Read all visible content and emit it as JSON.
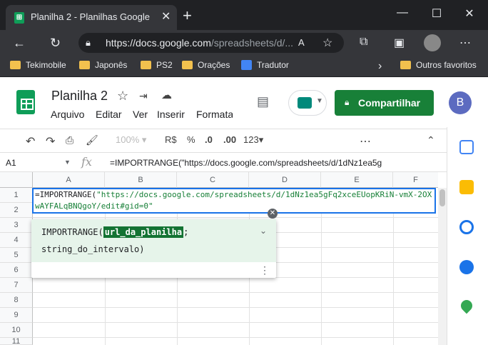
{
  "browser": {
    "tab_title": "Planilha 2 - Planilhas Google",
    "tab_favicon": "sheets-icon",
    "url_main": "https://docs.google.com",
    "url_path": "/spreadsheets/d/...",
    "bookmarks": [
      "Tekimobile",
      "Japonês",
      "PS2",
      "Orações",
      "Tradutor"
    ],
    "other_favorites": "Outros favoritos",
    "bookmarks_more": "›"
  },
  "app": {
    "title": "Planilha 2",
    "menus": [
      "Arquivo",
      "Editar",
      "Ver",
      "Inserir",
      "Formata"
    ],
    "share_label": "Compartilhar",
    "avatar_letter": "B",
    "accent": "#188038"
  },
  "toolbar": {
    "zoom": "100%",
    "currency": "R$",
    "percent": "%",
    "dec_less": ".0",
    "dec_more": ".00",
    "format": "123"
  },
  "formula_bar": {
    "cell_ref": "A1",
    "fx": "fx",
    "text": "=IMPORTRANGE(\"https://docs.google.com/spreadsheets/d/1dNz1ea5g"
  },
  "grid": {
    "columns": [
      "A",
      "B",
      "C",
      "D",
      "E",
      "F"
    ],
    "rows": [
      "1",
      "2",
      "3",
      "4",
      "5",
      "6",
      "7",
      "8",
      "9",
      "10",
      "11"
    ]
  },
  "editor": {
    "fn": "=IMPORTRANGE(",
    "arg": "\"https://docs.google.com/spreadsheets/d/1dNz1ea5gFq2xceEUopKRiN-vmX-2OXwAYFALqBNQgoY/edit#gid=0\""
  },
  "popup": {
    "fn_name": "IMPORTRANGE(",
    "arg1": "url_da_planilha",
    "sep": ";",
    "arg2": "string_do_intervalo)"
  }
}
